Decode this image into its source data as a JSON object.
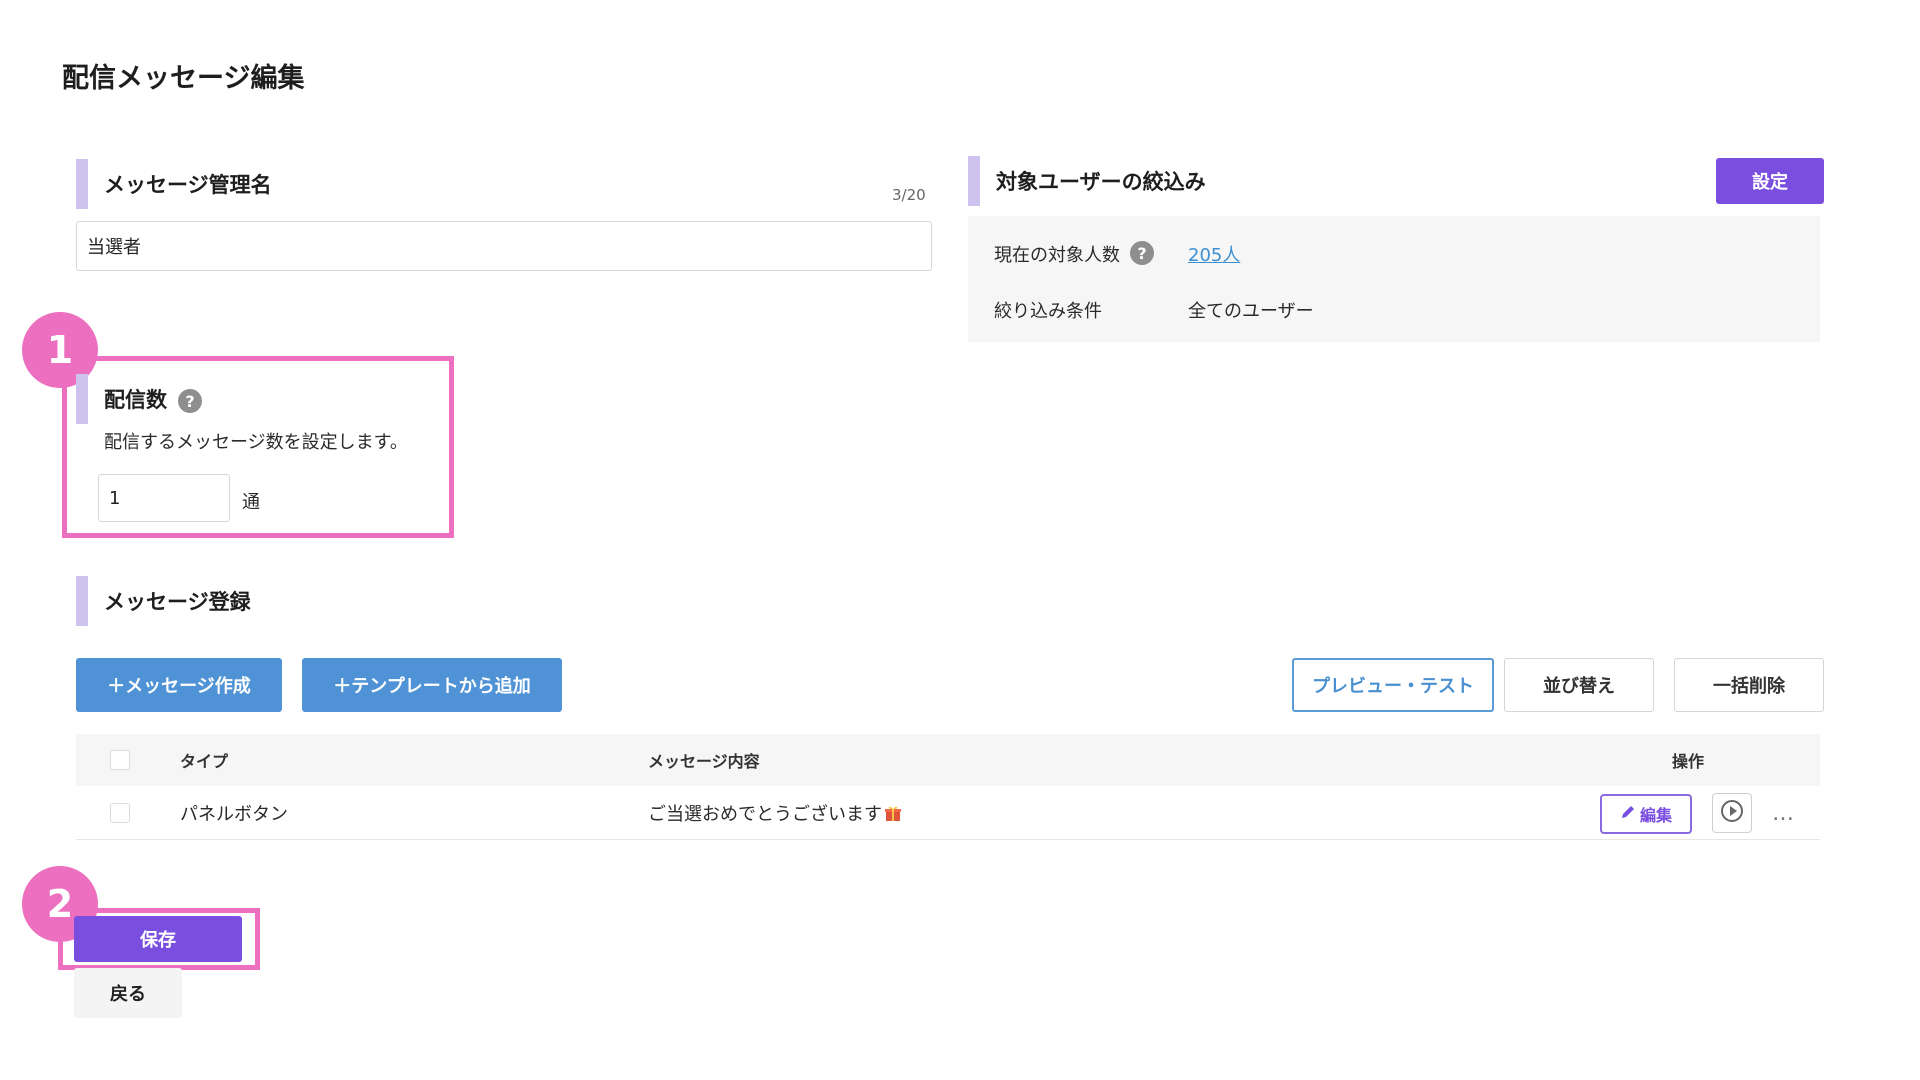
{
  "page_title": "配信メッセージ編集",
  "message_name": {
    "title": "メッセージ管理名",
    "counter": "3/20",
    "value": "当選者"
  },
  "target_filter": {
    "title": "対象ユーザーの絞込み",
    "settings_button": "設定",
    "current_count_label": "現在の対象人数",
    "current_count_value": "205人",
    "condition_label": "絞り込み条件",
    "condition_value": "全てのユーザー"
  },
  "delivery_count": {
    "title": "配信数",
    "description": "配信するメッセージ数を設定します。",
    "value": "1",
    "unit": "通"
  },
  "message_registration": {
    "title": "メッセージ登録",
    "create_button": "＋メッセージ作成",
    "template_button": "＋テンプレートから追加",
    "preview_button": "プレビュー・テスト",
    "sort_button": "並び替え",
    "bulk_delete_button": "一括削除",
    "columns": {
      "type": "タイプ",
      "content": "メッセージ内容",
      "actions": "操作"
    },
    "rows": [
      {
        "type": "パネルボタン",
        "content": "ご当選おめでとうございます",
        "edit_label": "編集"
      }
    ]
  },
  "annotations": {
    "step1": "1",
    "step2": "2"
  },
  "footer": {
    "save_button": "保存",
    "back_button": "戻る"
  },
  "colors": {
    "accent_purple": "#7a4fe0",
    "button_blue": "#4f93d6",
    "highlight_pink": "#ec6fc0",
    "section_bar": "#cdc3ee",
    "link_blue": "#3d8fd1"
  },
  "icons": {
    "help": "help-icon",
    "edit": "pencil-icon",
    "preview": "play-icon",
    "more": "ellipsis-icon",
    "emoji": "gift-icon"
  }
}
